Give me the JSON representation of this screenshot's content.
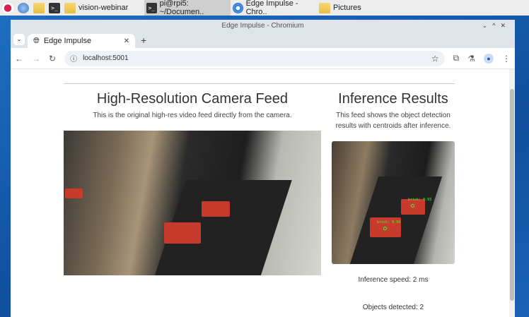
{
  "taskbar": {
    "items": [
      {
        "label": "",
        "icon": "raspberry-menu-icon"
      },
      {
        "label": "",
        "icon": "browser-icon"
      },
      {
        "label": "",
        "icon": "file-manager-icon"
      },
      {
        "label": "",
        "icon": "terminal-icon"
      },
      {
        "label": "vision-webinar",
        "icon": "folder-icon"
      },
      {
        "label": "pi@rpi5: ~/Documen..",
        "icon": "terminal-icon"
      },
      {
        "label": "Edge Impulse - Chro..",
        "icon": "chromium-icon"
      },
      {
        "label": "Pictures",
        "icon": "folder-icon"
      }
    ]
  },
  "window": {
    "title": "Edge Impulse - Chromium"
  },
  "tab": {
    "title": "Edge Impulse"
  },
  "address": {
    "url": "localhost:5001"
  },
  "left": {
    "title": "High-Resolution Camera Feed",
    "subtitle": "This is the original high-res video feed directly from the camera."
  },
  "right": {
    "title": "Inference Results",
    "subtitle": "This feed shows the object detection results with centroids after inference.",
    "detections": [
      {
        "label": "brick: 0.93"
      },
      {
        "label": "brick: 0.99"
      }
    ],
    "speed": "Inference speed: 2 ms",
    "objects": "Objects detected: 2"
  }
}
